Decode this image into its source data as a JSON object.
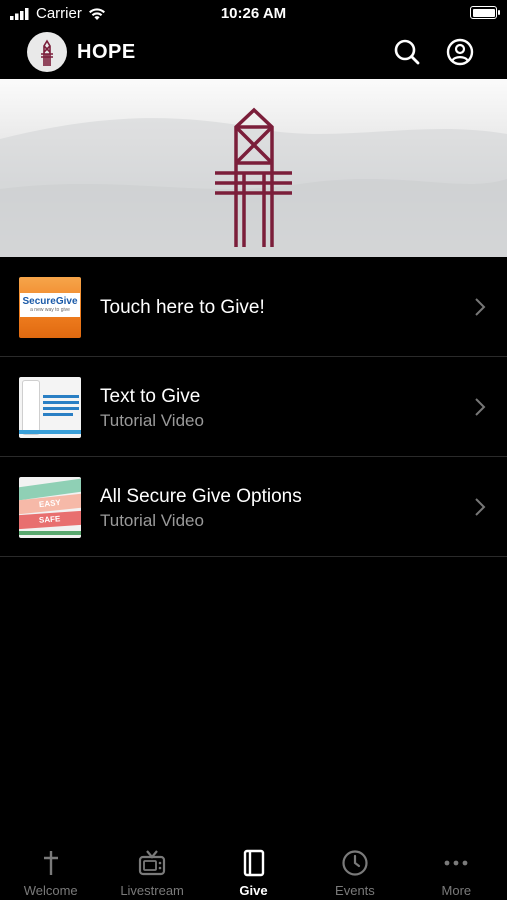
{
  "status_bar": {
    "carrier": "Carrier",
    "time": "10:26 AM"
  },
  "header": {
    "title": "HOPE"
  },
  "colors": {
    "brand": "#7b1e3a",
    "background": "#000000",
    "muted": "#9a9a9a"
  },
  "items": [
    {
      "title": "Touch here to Give!",
      "subtitle": "",
      "thumb_text": "SecureGive",
      "thumb_tagline": "a new way to give"
    },
    {
      "title": "Text to Give",
      "subtitle": "Tutorial Video"
    },
    {
      "title": "All Secure Give Options",
      "subtitle": "Tutorial Video",
      "thumb_words": [
        "EASY",
        "SAFE"
      ]
    }
  ],
  "tabs": [
    {
      "label": "Welcome",
      "icon": "cross-icon",
      "active": false
    },
    {
      "label": "Livestream",
      "icon": "tv-icon",
      "active": false
    },
    {
      "label": "Give",
      "icon": "book-icon",
      "active": true
    },
    {
      "label": "Events",
      "icon": "clock-icon",
      "active": false
    },
    {
      "label": "More",
      "icon": "more-icon",
      "active": false
    }
  ]
}
